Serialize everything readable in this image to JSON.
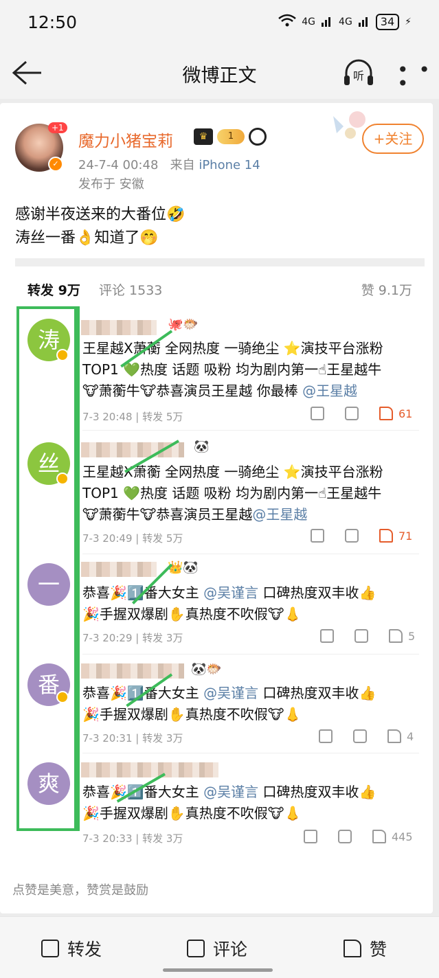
{
  "status": {
    "time": "12:50",
    "signal1": "4G",
    "signal2": "4G",
    "battery": "34"
  },
  "nav": {
    "title": "微博正文",
    "back_icon": "back-arrow-icon",
    "listen_label": "听",
    "more": "• • •"
  },
  "post": {
    "username": "魔力小猪宝莉",
    "avatar_badge": "+1",
    "avatar_v": "✓",
    "level": "1",
    "timestamp": "24-7-4 00:48",
    "source_prefix": "来自",
    "device": "iPhone 14",
    "location": "发布于 安徽",
    "follow_label": "+关注",
    "text_line1": "感谢半夜送来的大番位🤣",
    "text_line2": "涛丝一番👌知道了🤭"
  },
  "tabs": {
    "repost": "转发 9万",
    "comments": "评论 1533",
    "likes": "赞 9.1万"
  },
  "reposts": [
    {
      "avatar_char": "涛",
      "avatar_color": "#8cc63f",
      "line1": "王星越X萧蘅 全网热度 一骑绝尘 ⭐演技平台涨粉",
      "line2": "TOP1 💚热度 话题 吸粉 均为剧内第一☝王星越牛",
      "line3": "🐮萧蘅牛🐮恭喜演员王星越 你最棒",
      "mention": "@王星越",
      "time": "7-3 20:48",
      "sep": "|",
      "repost_count": "转发 5万",
      "likes": "61",
      "liked": true
    },
    {
      "avatar_char": "丝",
      "avatar_color": "#8cc63f",
      "line1": "王星越X萧蘅 全网热度 一骑绝尘 ⭐演技平台涨粉",
      "line2": "TOP1 💚热度 话题 吸粉 均为剧内第一☝王星越牛",
      "line3": "🐮萧蘅牛🐮恭喜演员王星越",
      "mention": "@王星越",
      "time": "7-3 20:49",
      "sep": "|",
      "repost_count": "转发 5万",
      "likes": "71",
      "liked": true
    },
    {
      "avatar_char": "一",
      "avatar_color": "#a58fc2",
      "line1_pre": "恭喜🎉1️⃣番大女主",
      "mention": "@吴谨言",
      "line1_post": "口碑热度双丰收👍",
      "line2": "🎉手握双爆剧✋真热度不吹假🐮👃",
      "time": "7-3 20:29",
      "sep": "|",
      "repost_count": "转发 3万",
      "likes": "5",
      "liked": false
    },
    {
      "avatar_char": "番",
      "avatar_color": "#a58fc2",
      "line1_pre": "恭喜🎉1️⃣番大女主",
      "mention": "@吴谨言",
      "line1_post": "口碑热度双丰收👍",
      "line2": "🎉手握双爆剧✋真热度不吹假🐮👃",
      "time": "7-3 20:31",
      "sep": "|",
      "repost_count": "转发 3万",
      "likes": "4",
      "liked": false
    },
    {
      "avatar_char": "爽",
      "avatar_color": "#a58fc2",
      "line1_pre": "恭喜🎉1️⃣番大女主",
      "mention": "@吴谨言",
      "line1_post": "口碑热度双丰收👍",
      "line2": "🎉手握双爆剧✋真热度不吹假🐮👃",
      "time": "7-3 20:33",
      "sep": "|",
      "repost_count": "转发 3万",
      "likes": "445",
      "liked": false
    }
  ],
  "tip": "点赞是美意，赞赏是鼓励",
  "bottom": {
    "repost": "转发",
    "comment": "评论",
    "like": "赞"
  },
  "colors": {
    "accent": "#e8692c",
    "link": "#5b7fa6",
    "annotation": "#3dbb5a"
  }
}
